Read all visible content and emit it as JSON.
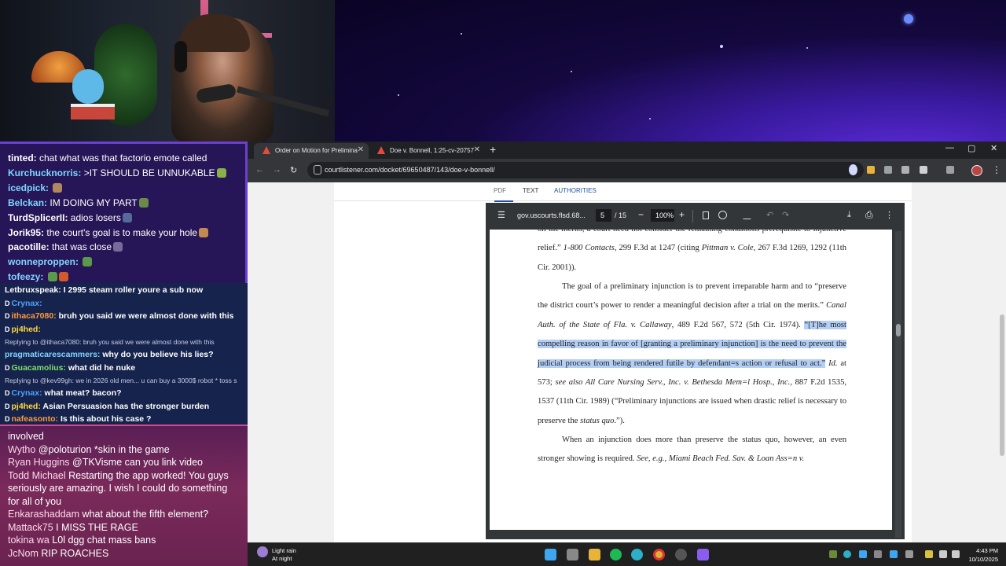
{
  "chat_top": [
    {
      "user": "tinted:",
      "text": "chat what was that factorio emote called",
      "color": "#ffffff",
      "emotes": []
    },
    {
      "user": "Kurchucknorris:",
      "text": ">IT SHOULD BE UNNUKABLE",
      "color": "#7fd6ff",
      "emotes": [
        "#8ab04a"
      ]
    },
    {
      "user": "icedpick:",
      "text": "",
      "color": "#7fd6ff",
      "emotes": [
        "#b08860"
      ]
    },
    {
      "user": "Belckan:",
      "text": "IM DOING MY PART",
      "color": "#7fd6ff",
      "emotes": [
        "#6a8b4a"
      ]
    },
    {
      "user": "TurdSplicerII:",
      "text": "adios losers",
      "color": "#ffffff",
      "emotes": [
        "#556a9a"
      ]
    },
    {
      "user": "Jorik95:",
      "text": "the court's goal is to make your hole",
      "color": "#ffffff",
      "emotes": [
        "#c08a50"
      ]
    },
    {
      "user": "pacotille:",
      "text": "that was close",
      "color": "#ffffff",
      "emotes": [
        "#7a6a9a"
      ]
    },
    {
      "user": "wonneproppen:",
      "text": "",
      "color": "#7fd6ff",
      "emotes": [
        "#5a9a4a"
      ]
    },
    {
      "user": "tofeezy:",
      "text": "",
      "color": "#7fd6ff",
      "emotes": [
        "#5a9a4a",
        "#d05a2a"
      ]
    }
  ],
  "chat_mid": [
    {
      "kind": "msg",
      "badge": "",
      "user": "Letbruxspeak:",
      "ucolor": "#ffffff",
      "text": "I 2995 steam roller youre a sub now"
    },
    {
      "kind": "msg",
      "badge": "D",
      "user": "Crynax:",
      "ucolor": "#4ea3ff",
      "text": ""
    },
    {
      "kind": "msg",
      "badge": "D",
      "user": "ithaca7080:",
      "ucolor": "#ff9a3c",
      "text": "bruh you said we were almost done with this"
    },
    {
      "kind": "msg",
      "badge": "D",
      "user": "pj4hed:",
      "ucolor": "#ffd93c",
      "text": ""
    },
    {
      "kind": "reply",
      "text": "Replying to @ithaca7080: bruh you said we were almost done with this"
    },
    {
      "kind": "msg",
      "badge": "",
      "user": "pragmaticarescammers:",
      "ucolor": "#7fd6ff",
      "text": "why do you believe his lies?"
    },
    {
      "kind": "msg",
      "badge": "D",
      "user": "Guacamolius:",
      "ucolor": "#7ee06a",
      "text": "what did he nuke"
    },
    {
      "kind": "reply",
      "text": "Replying to @kev99gh: we in 2026 old men... u can buy a 3000$ robot * toss s"
    },
    {
      "kind": "msg",
      "badge": "D",
      "user": "Crynax:",
      "ucolor": "#4ea3ff",
      "text": "what meat? bacon?"
    },
    {
      "kind": "msg",
      "badge": "D",
      "user": "pj4hed:",
      "ucolor": "#ffd93c",
      "text": "Asian Persuasion has the stronger burden"
    },
    {
      "kind": "msg",
      "badge": "D",
      "user": "nafeasonto:",
      "ucolor": "#ff9a3c",
      "text": "Is this about his case ?"
    }
  ],
  "chat_bottom": [
    {
      "user": "",
      "text": "involved"
    },
    {
      "user": "Wytho",
      "text": "@poloturion *skin in the game"
    },
    {
      "user": "Ryan Huggins",
      "text": "@TKVisme can you link video"
    },
    {
      "user": "Todd Michael",
      "text": "Restarting the app worked! You guys seriously are amazing. I wish I could do something for all of you"
    },
    {
      "user": "Enkarashaddam",
      "text": "what about the fifth element?"
    },
    {
      "user": "Mattack75",
      "text": "I MISS THE RAGE"
    },
    {
      "user": "tokina wa",
      "text": "L0l dgg chat mass bans"
    },
    {
      "user": "JcNom",
      "text": "RIP ROACHES"
    }
  ],
  "browser": {
    "tabs": [
      {
        "label": "Order on Motion for Prelimina",
        "active": true
      },
      {
        "label": "Doe v. Bonnell, 1:25-cv-20757",
        "active": false
      }
    ],
    "new_tab": "+",
    "minimize": "—",
    "maximize": "▢",
    "close": "✕",
    "back": "←",
    "forward": "→",
    "reload": "↻",
    "url": "courtlistener.com/docket/69650487/143/doe-v-bonnell/",
    "bookmark_star": "☆",
    "menu": "⋮"
  },
  "viewer_tabs": [
    "PDF",
    "TEXT",
    "AUTHORITIES"
  ],
  "pdf": {
    "menu": "☰",
    "title": "gov.uscourts.flsd.68...",
    "page": "5",
    "page_total": "/ 15",
    "zoom_out": "−",
    "zoom": "100%",
    "zoom_in": "+",
    "download": "⤓",
    "print": "⎙",
    "more": "⋮",
    "undo": "↶",
    "redo": "↷"
  },
  "pdf_text": {
    "p0a": "on the merits, a court need not consider the remaining conditions prerequisite to injunctive relief.”",
    "p0b": "1-800 Contacts",
    "p0c": ", 299 F.3d at 1247 (citing",
    "p0d": "Pittman v. Cole",
    "p0e": ", 267 F.3d 1269, 1292 (11th Cir. 2001)).",
    "p1a": "The goal of a preliminary injunction is to prevent irreparable harm and to “preserve the district court’s power to render a meaningful decision after a trial on the merits.”",
    "p1b": "Canal Auth. of the State of Fla. v. Callaway",
    "p1c": ", 489 F.2d 567, 572 (5th Cir. 1974).",
    "p1hl": "“[T]he most compelling reason in favor of [granting a preliminary injunction] is the need to prevent the judicial process from being rendered futile by defendant=s action or refusal to act.”",
    "p1d": "Id.",
    "p1e": "at 573;",
    "p1f": "see also All Care Nursing Serv., Inc. v. Bethesda Mem=l Hosp., Inc.",
    "p1g": ", 887 F.2d 1535, 1537 (11th Cir. 1989) (“Preliminary injunctions are issued when drastic relief is necessary to preserve the",
    "p1h": "status quo",
    "p1i": ".”).",
    "p2a": "When an injunction does more than preserve the status quo, however, an even stronger showing is required.",
    "p2b": "See, e.g., Miami Beach Fed. Sav. & Loan Ass=n v."
  },
  "taskbar": {
    "weather_line1": "Light rain",
    "weather_line2": "At night",
    "time": "4:43 PM",
    "date": "10/10/2025"
  }
}
